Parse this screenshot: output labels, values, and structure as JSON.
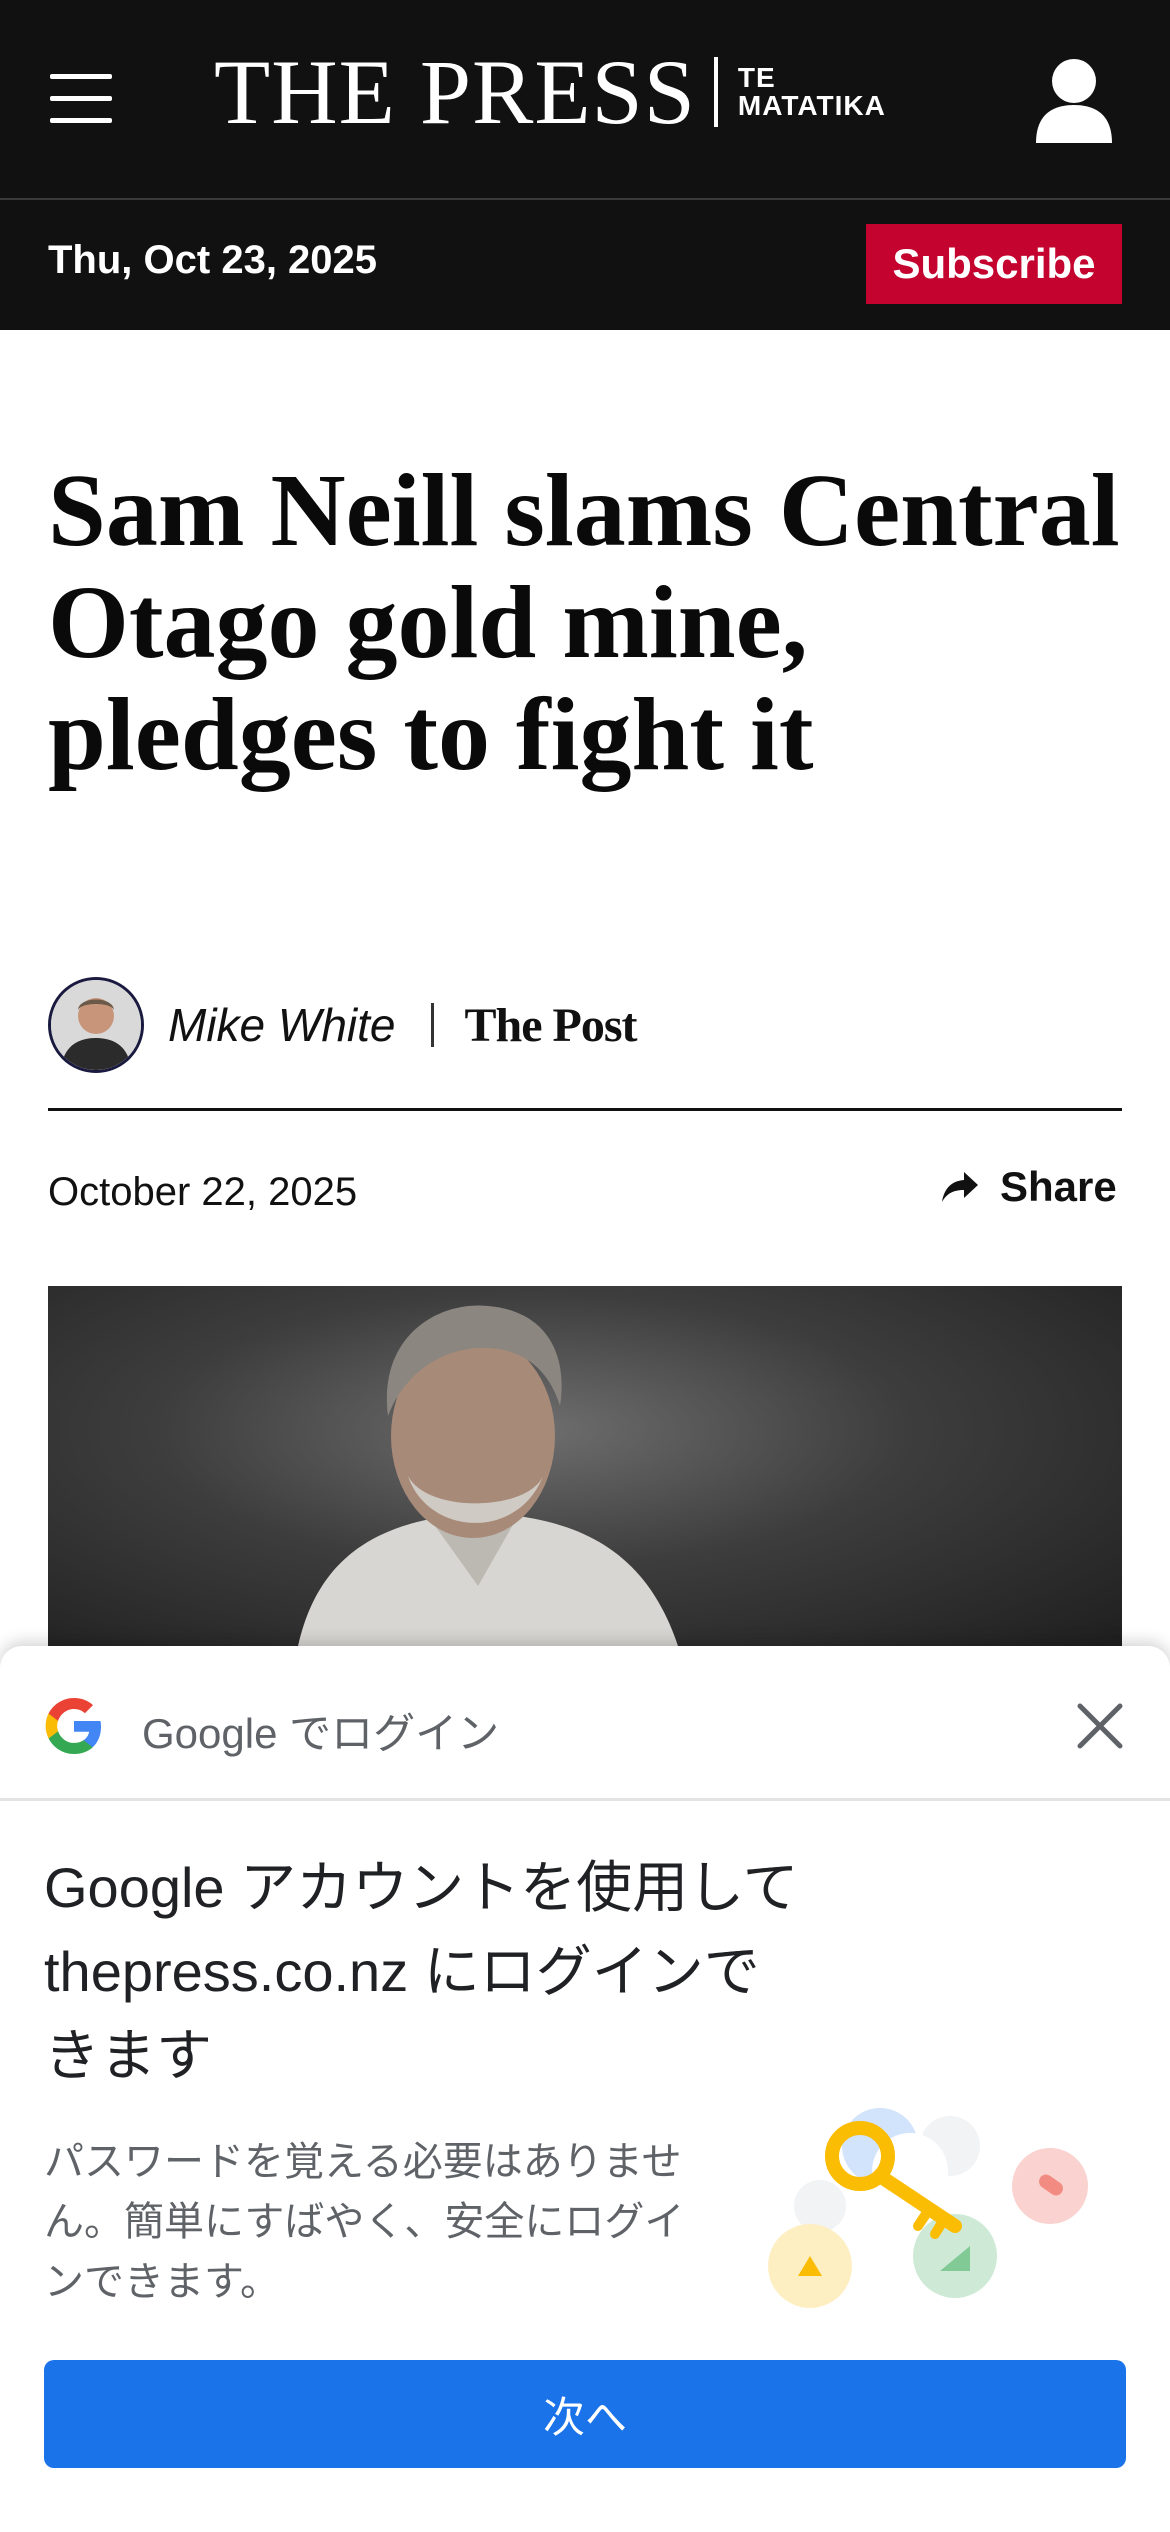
{
  "header": {
    "logo_main": "THE PRESS",
    "logo_sub_line1": "TE",
    "logo_sub_line2": "MATATIKA",
    "menu_icon": "hamburger-menu-icon",
    "user_icon": "user-account-icon"
  },
  "datebar": {
    "date": "Thu, Oct 23, 2025",
    "subscribe_label": "Subscribe"
  },
  "article": {
    "headline": "Sam Neill slams Central Otago gold mine, pledges to fight it",
    "author": "Mike White",
    "outlet": "The Post",
    "published": "October 22, 2025",
    "share_label": "Share",
    "share_icon": "share-arrow-icon"
  },
  "google_sheet": {
    "title": "Google でログイン",
    "heading": "Google アカウントを使用して thepress.co.nz にログインできます",
    "description": "パスワードを覚える必要はありません。簡単にすばやく、安全にログインできます。",
    "next_label": "次へ",
    "close_icon": "close-x-icon",
    "illustration_icon": "key-illustration-icon"
  },
  "colors": {
    "header_bg": "#111111",
    "subscribe_bg": "#c4032f",
    "google_blue": "#1a73e8",
    "secondary_text": "#5f6368"
  }
}
